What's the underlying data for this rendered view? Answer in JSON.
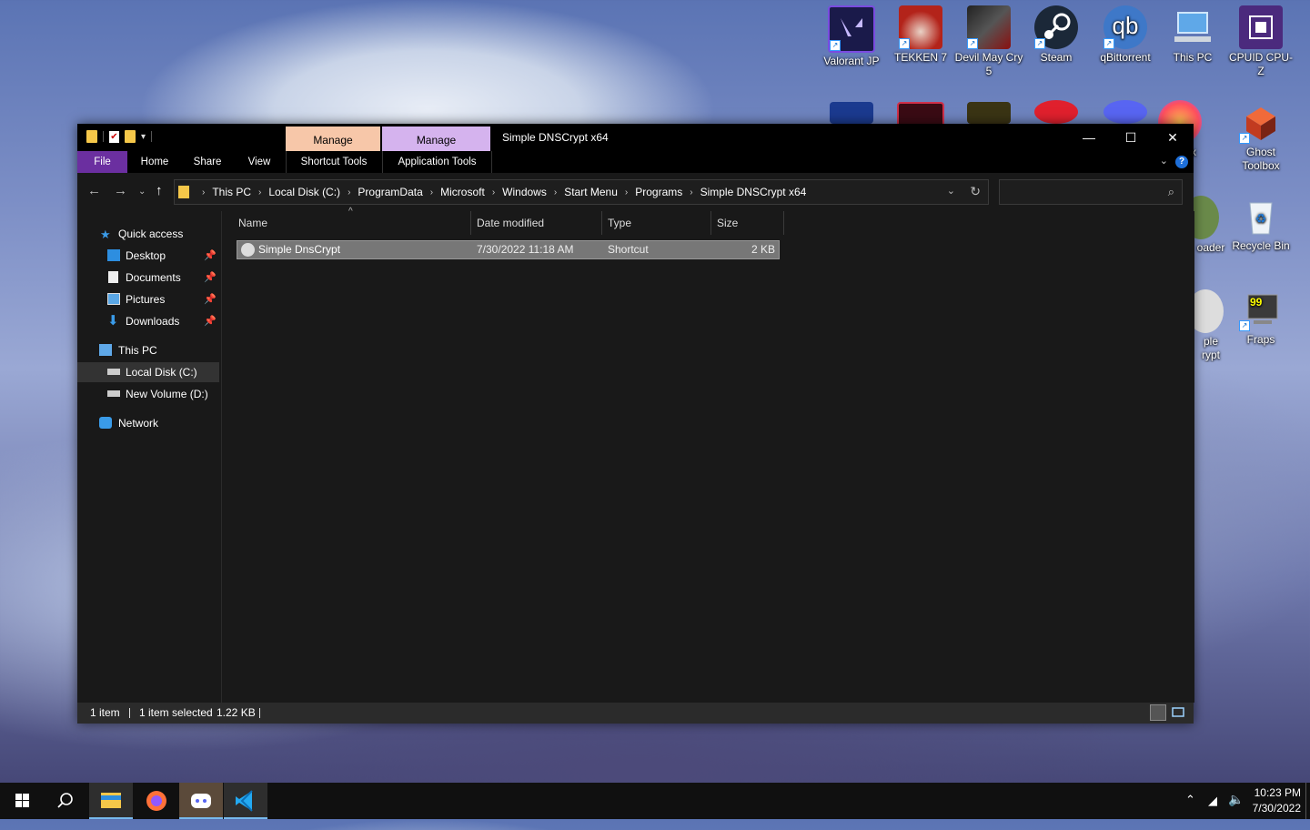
{
  "desktop": {
    "icons": [
      {
        "label": "Valorant JP",
        "icon": "valorant-icon",
        "color": "#1a1a4a"
      },
      {
        "label": "TEKKEN 7",
        "icon": "tekken-icon",
        "color": "#b3231a"
      },
      {
        "label": "Devil May Cry 5",
        "icon": "dmc5-icon",
        "color": "#1a1a1a"
      },
      {
        "label": "Steam",
        "icon": "steam-icon",
        "color": "#1b2838"
      },
      {
        "label": "qBittorrent",
        "icon": "qbittorrent-icon",
        "color": "#3e78c8"
      },
      {
        "label": "This PC",
        "icon": "this-pc-icon",
        "color": "#5fa8e8"
      },
      {
        "label": "CPUID CPU-Z",
        "icon": "cpuz-icon",
        "color": "#4b2a7d"
      },
      {
        "label": "Ghost Toolbox",
        "icon": "ghost-toolbox-icon",
        "color": "#e0522c"
      },
      {
        "label": "Recycle Bin",
        "icon": "recycle-bin-icon",
        "color": "#dfe7f0"
      },
      {
        "label": "Fraps",
        "icon": "fraps-icon",
        "color": "#333333"
      }
    ],
    "partial_labels": [
      "fox",
      "oader",
      "ple",
      "rypt"
    ]
  },
  "window": {
    "title": "Simple DNSCrypt x64",
    "context_tabs": [
      "Manage",
      "Manage"
    ],
    "ribbon_tabs": [
      "File",
      "Home",
      "Share",
      "View"
    ],
    "context_subtabs": [
      "Shortcut Tools",
      "Application Tools"
    ],
    "address": [
      "This PC",
      "Local Disk (C:)",
      "ProgramData",
      "Microsoft",
      "Windows",
      "Start Menu",
      "Programs",
      "Simple DNSCrypt x64"
    ],
    "search_placeholder": "",
    "nav": {
      "quick_access": "Quick access",
      "desktop": "Desktop",
      "documents": "Documents",
      "pictures": "Pictures",
      "downloads": "Downloads",
      "this_pc": "This PC",
      "local_disk": "Local Disk (C:)",
      "new_volume": "New Volume (D:)",
      "network": "Network"
    },
    "columns": {
      "name": "Name",
      "date": "Date modified",
      "type": "Type",
      "size": "Size"
    },
    "files": [
      {
        "name": "Simple DnsCrypt",
        "date": "7/30/2022 11:18 AM",
        "type": "Shortcut",
        "size": "2 KB"
      }
    ],
    "status": {
      "count": "1 item",
      "selected": "1 item selected",
      "size": "1.22 KB"
    }
  },
  "taskbar": {
    "time": "10:23 PM",
    "date": "7/30/2022"
  },
  "colors": {
    "file_tab": "#6b2fa0",
    "manage_shortcut": "#f7c7a9",
    "manage_app": "#d5b3ee",
    "window_bg": "#191919",
    "selection": "#777777"
  }
}
